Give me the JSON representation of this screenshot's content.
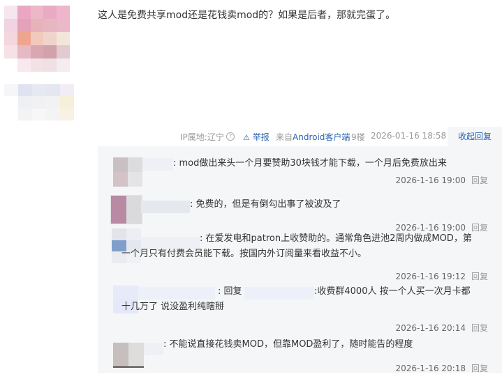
{
  "post": {
    "text": "这人是免费共享mod还是花钱卖mod的？如果是后者，那就完蛋了。"
  },
  "meta": {
    "ip": "IP属地:辽宁",
    "help_icon": "question-circle-icon",
    "report_icon": "warning-triangle-icon",
    "report": "举报",
    "source_prefix": "来自",
    "source_client": "Android客户端",
    "floor": "9楼",
    "time": "2026-01-16 18:58",
    "fold_replies": "收起回复"
  },
  "replies": [
    {
      "text": "mod做出来头一个月要赞助30块钱才能下载，一个月后免费放出来",
      "time": "2026-1-16 19:00",
      "reply_label": "回复"
    },
    {
      "text": "免费的，但是有倒勾出事了被波及了",
      "time": "2026-1-16 19:00",
      "reply_label": "回复"
    },
    {
      "text_line1": "在爱发电和patron上收赞助的。通常角色进池2周内做成MOD，第",
      "text_line2": "一个月只有付费会员能下载。按国内外订阅量来看收益不小。",
      "time": "2026-1-16 19:12",
      "reply_label": "回复"
    },
    {
      "prefix": "回复",
      "text_line1": "收费群4000人 按一个人买一次月卡都",
      "text_line2": "十几万了 说没盈利纯瞎掰",
      "time": "2026-1-16 20:14",
      "reply_label": "回复"
    },
    {
      "text": "不能说直接花钱卖MOD，但靠MOD盈利了，随时能告的程度",
      "time": "2026-1-16 20:18",
      "reply_label": "回复"
    }
  ]
}
